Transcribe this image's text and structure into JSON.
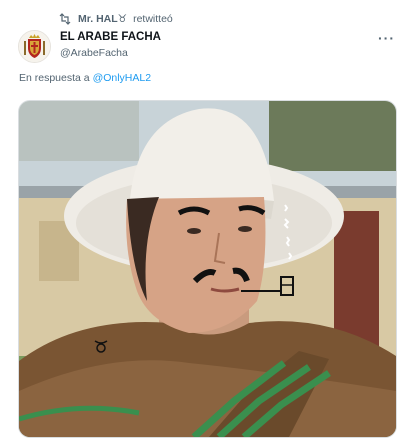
{
  "retweet": {
    "retweeter": "Mr. HAL",
    "retweeter_glyph": "♉︎",
    "action": "retwitteó"
  },
  "author": {
    "display_name": "EL ARABE FACHA",
    "handle": "@ArabeFacha"
  },
  "reply": {
    "prefix": "En respuesta a",
    "mention": "@OnlyHAL2"
  },
  "icons": {
    "retweet": "retweet-icon",
    "more": "more-options-icon",
    "avatar": "coat-of-arms-avatar"
  },
  "colors": {
    "text_primary": "#0f1419",
    "text_secondary": "#536471",
    "link": "#1d9bf0",
    "border": "#d9dde0"
  }
}
